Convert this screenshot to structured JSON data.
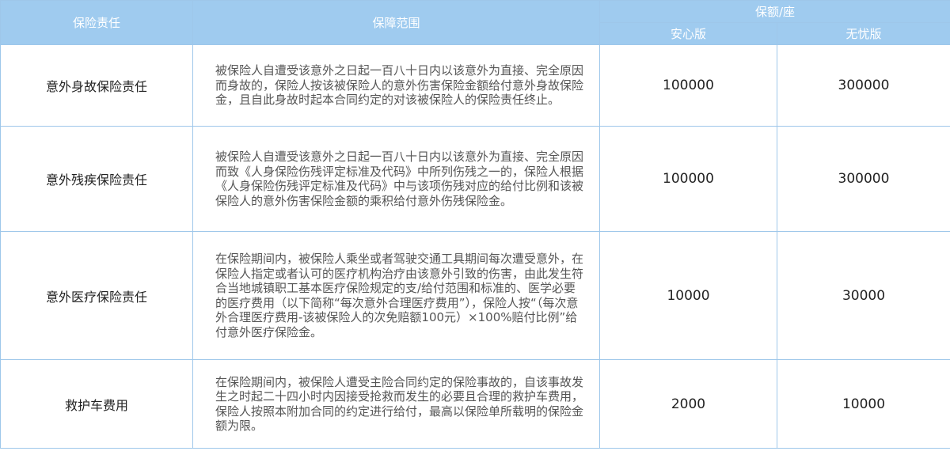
{
  "header": {
    "col_duty": "保险责任",
    "col_scope": "保障范围",
    "col_amount": "保额/座",
    "plan_a": "安心版",
    "plan_b": "无忧版"
  },
  "rows": [
    {
      "name": "意外身故保险责任",
      "scope": "被保险人自遭受该意外之日起一百八十日内以该意外为直接、完全原因而身故的，保险人按该被保险人的意外伤害保险金额给付意外身故保险金，且自此身故时起本合同约定的对该被保险人的保险责任终止。",
      "plan_a": "100000",
      "plan_b": "300000"
    },
    {
      "name": "意外残疾保险责任",
      "scope": "被保险人自遭受该意外之日起一百八十日内以该意外为直接、完全原因而致《人身保险伤残评定标准及代码》中所列伤残之一的，保险人根据《人身保险伤残评定标准及代码》中与该项伤残对应的给付比例和该被保险人的意外伤害保险金额的乘积给付意外伤残保险金。",
      "plan_a": "100000",
      "plan_b": "300000"
    },
    {
      "name": "意外医疗保险责任",
      "scope": "在保险期间内，被保险人乘坐或者驾驶交通工具期间每次遭受意外，在保险人指定或者认可的医疗机构治疗由该意外引致的伤害，由此发生符合当地城镇职工基本医疗保险规定的支/给付范围和标准的、医学必要的医疗费用（以下简称“每次意外合理医疗费用”），保险人按“（每次意外合理医疗费用-该被保险人的次免赔额100元）×100%赔付比例”给付意外医疗保险金。",
      "plan_a": "10000",
      "plan_b": "30000"
    },
    {
      "name": "救护车费用",
      "scope": "在保险期间内，被保险人遭受主险合同约定的保险事故的，自该事故发生之时起二十四小时内因接受抢救而发生的必要且合理的救护车费用，保险人按照本附加合同的约定进行给付，最高以保险单所载明的保险金额为限。",
      "plan_a": "2000",
      "plan_b": "10000"
    }
  ]
}
